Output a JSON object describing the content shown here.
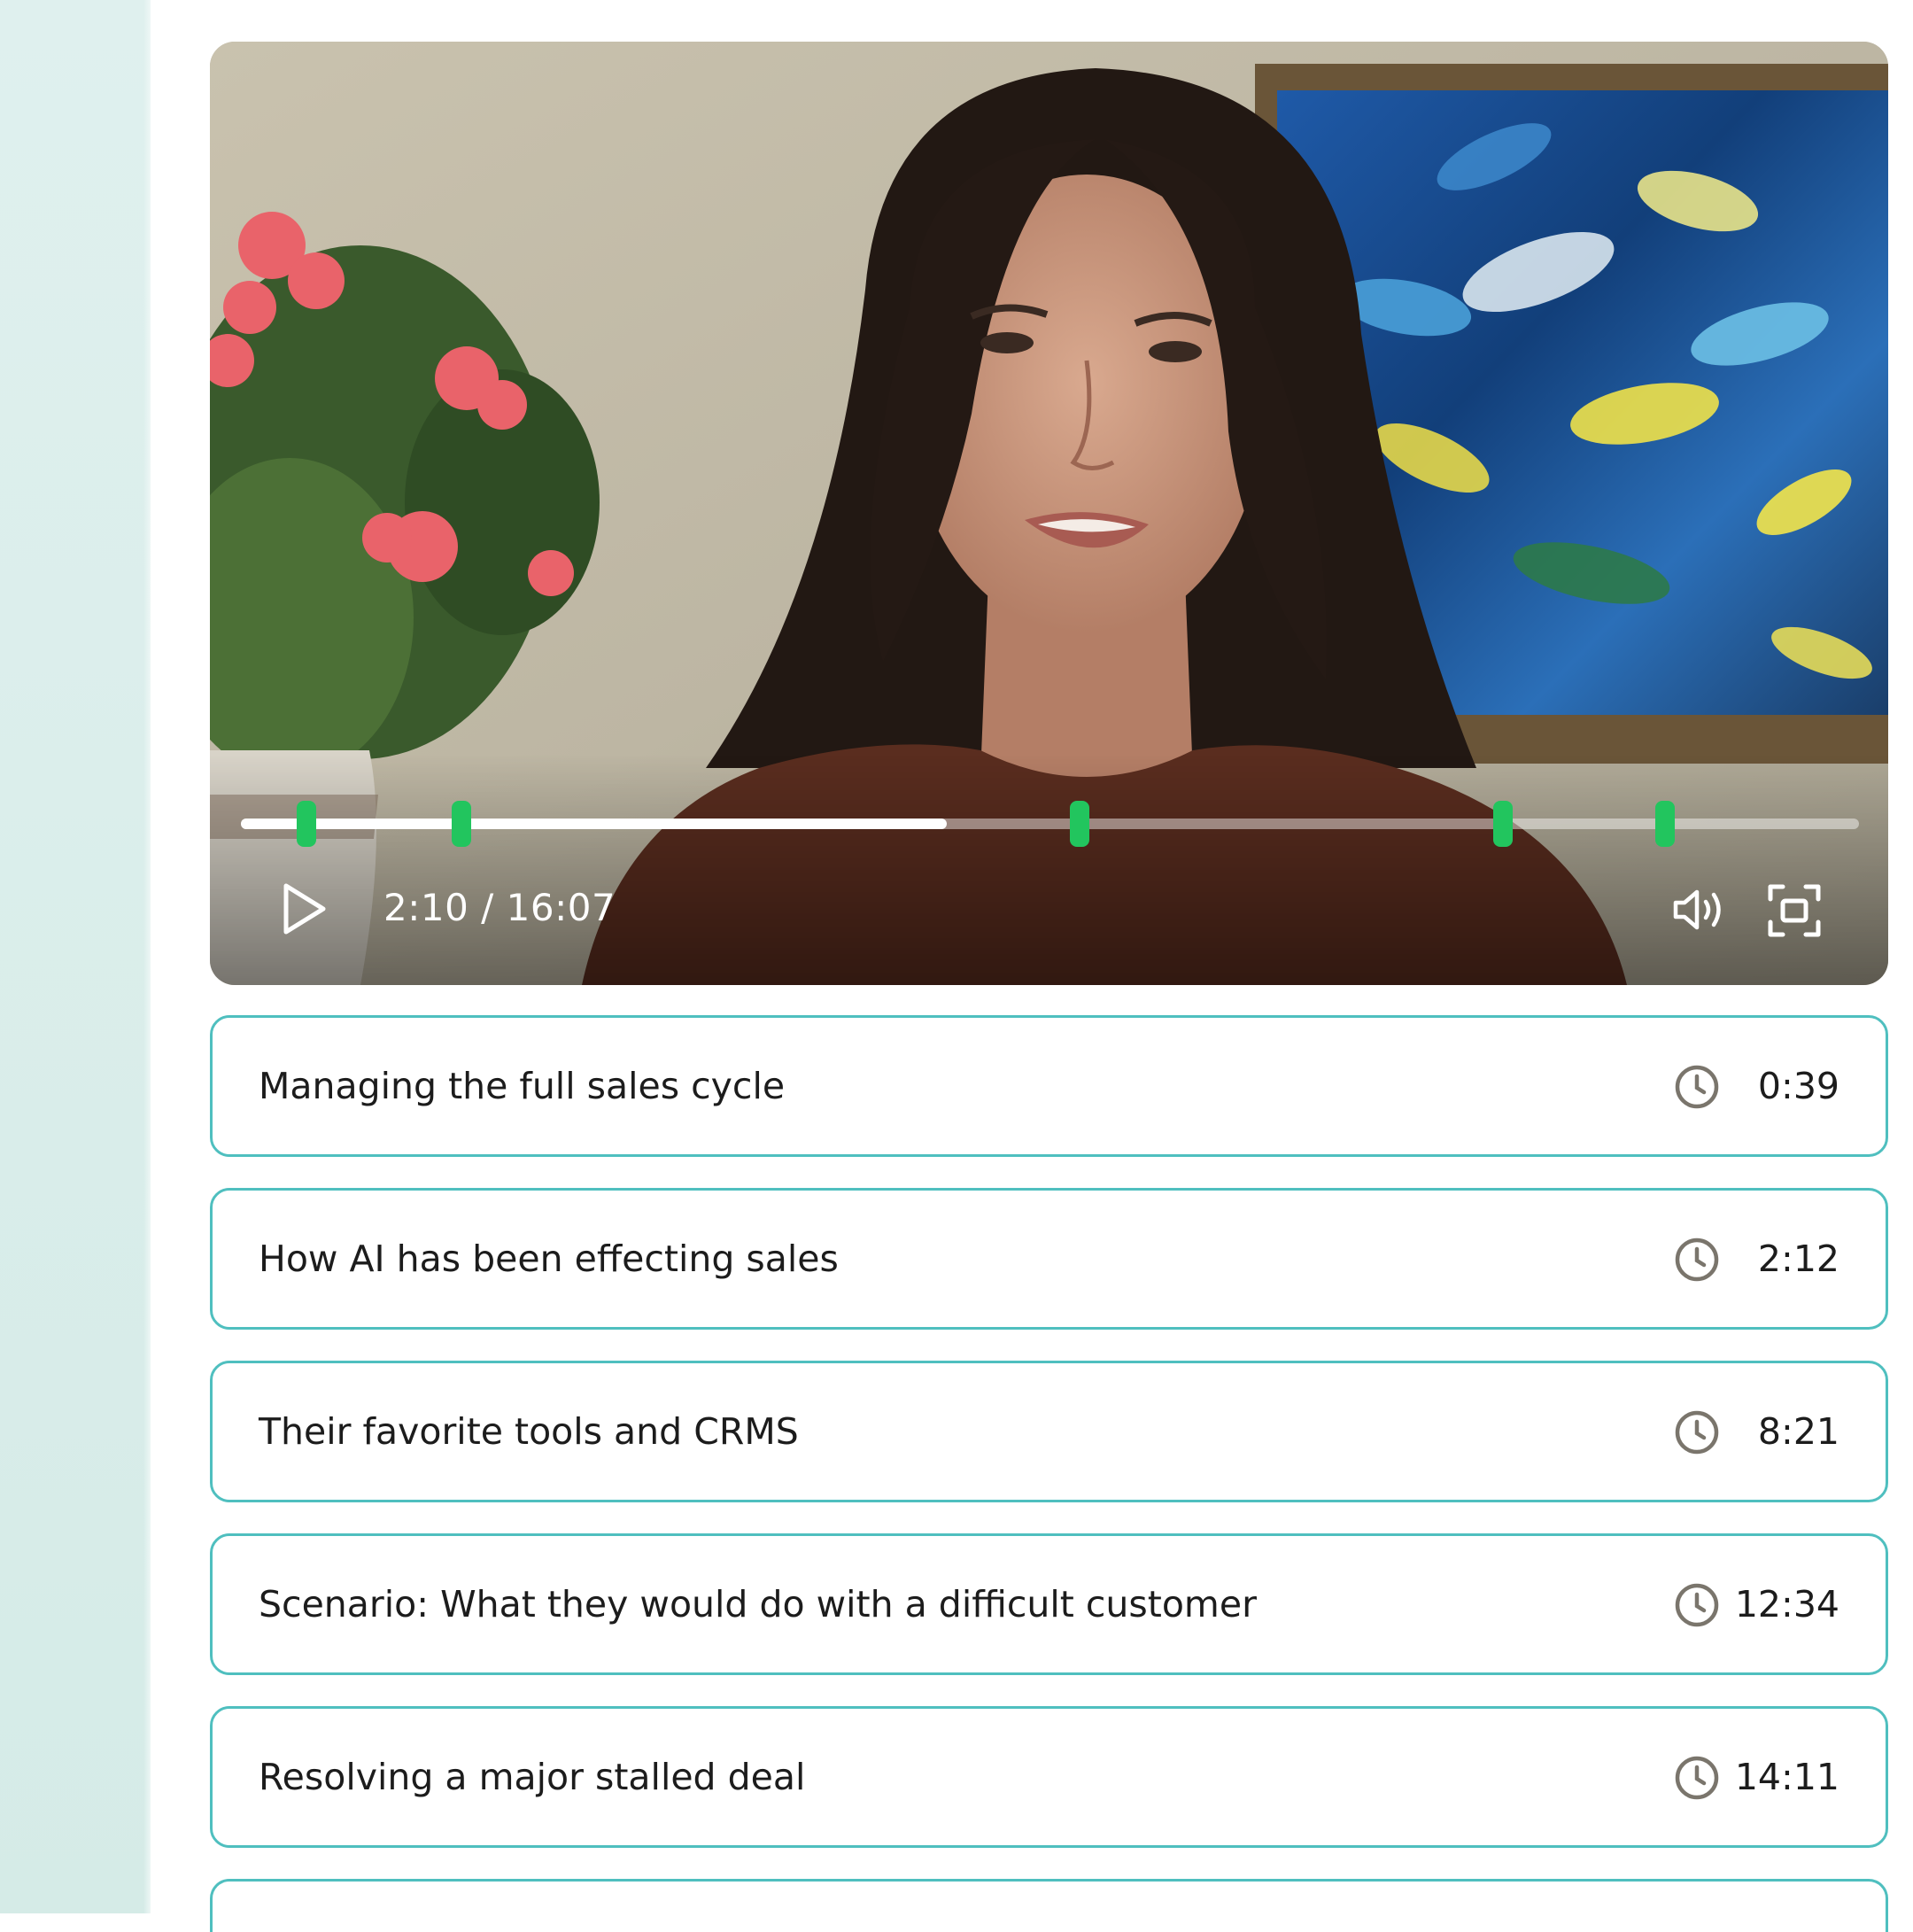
{
  "player": {
    "time_display": "2:10 / 16:07",
    "progress_fraction": 0.436,
    "duration_seconds": 967,
    "chapter_marker_seconds": [
      39,
      132,
      501,
      754,
      851
    ],
    "marker_color": "#22c55e",
    "play_icon": "play-icon",
    "volume_icon": "volume-icon",
    "fullscreen_icon": "fullscreen-icon"
  },
  "chapters": [
    {
      "label": "Managing the full sales cycle",
      "time": "0:39",
      "icon": "clock-icon"
    },
    {
      "label": "How AI has been effecting sales",
      "time": "2:12",
      "icon": "clock-icon"
    },
    {
      "label": "Their favorite tools and CRMS",
      "time": "8:21",
      "icon": "clock-icon"
    },
    {
      "label": "Scenario: What they would do with a difficult customer",
      "time": "12:34",
      "icon": "clock-icon"
    },
    {
      "label": "Resolving a major stalled deal",
      "time": "14:11",
      "icon": "clock-icon"
    }
  ],
  "colors": {
    "accent_border": "#4fbfbf",
    "sidebar_bg": "#d9eeeb",
    "marker": "#22c55e"
  }
}
